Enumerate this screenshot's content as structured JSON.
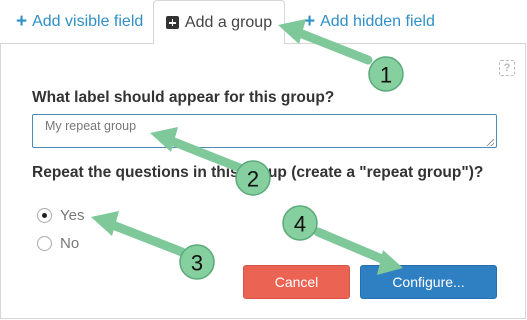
{
  "tabs": {
    "add_visible_field": "Add visible field",
    "add_group": "Add a group",
    "add_hidden_field": "Add hidden field"
  },
  "form": {
    "group_label_question": "What label should appear for this group?",
    "group_label_value": "My repeat group",
    "repeat_question": "Repeat the questions in this group (create a \"repeat group\")?",
    "options": [
      {
        "label": "Yes",
        "selected": true
      },
      {
        "label": "No",
        "selected": false
      }
    ]
  },
  "buttons": {
    "cancel": "Cancel",
    "configure": "Configure..."
  },
  "annotations": {
    "markers": [
      "1",
      "2",
      "3",
      "4"
    ],
    "arrow_color": "#7fc89a"
  },
  "colors": {
    "link": "#2f8fc9",
    "cancel": "#ea6353",
    "configure": "#2f7fc3"
  }
}
